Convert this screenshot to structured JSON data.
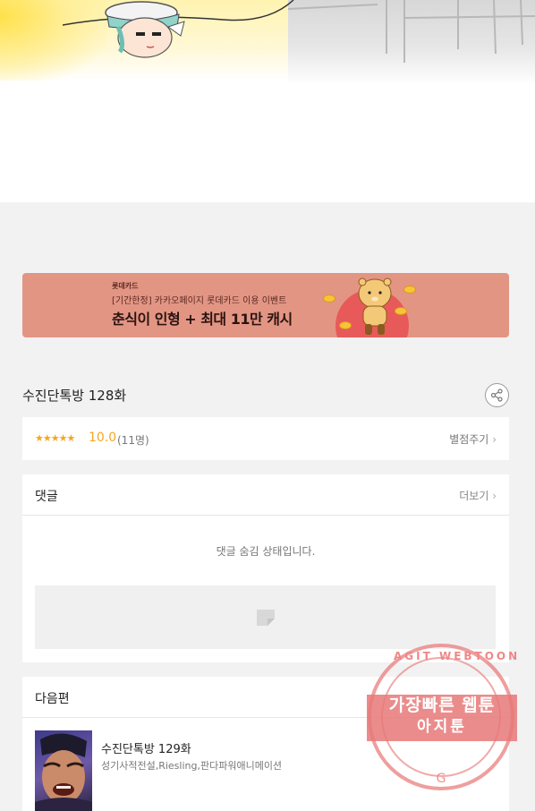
{
  "banner": {
    "brand": "롯데카드",
    "subtitle": "[기간한정] 카카오페이지 롯데카드 이용 이벤트",
    "headline": "춘식이 인형 + 최대 11만 캐시"
  },
  "episode": {
    "title": "수진단톡방 128화",
    "rating": {
      "stars": "★★★★★",
      "score": "10.0",
      "count": "(11명)",
      "rate_label": "별점주기"
    }
  },
  "comments": {
    "heading": "댓글",
    "more_label": "더보기",
    "hidden_message": "댓글 숨김 상태입니다."
  },
  "next": {
    "heading": "다음편",
    "title": "수진단톡방 129화",
    "meta": "성기사적전설,Riesling,판다파워애니메이션"
  },
  "watermark": {
    "line1": "가장빠른 웹툰",
    "line2": "아지툰",
    "arc": "AGIT WEBTOON"
  },
  "colors": {
    "star": "#f5a623",
    "banner_bg": "#e39584",
    "watermark": "#e87878"
  }
}
